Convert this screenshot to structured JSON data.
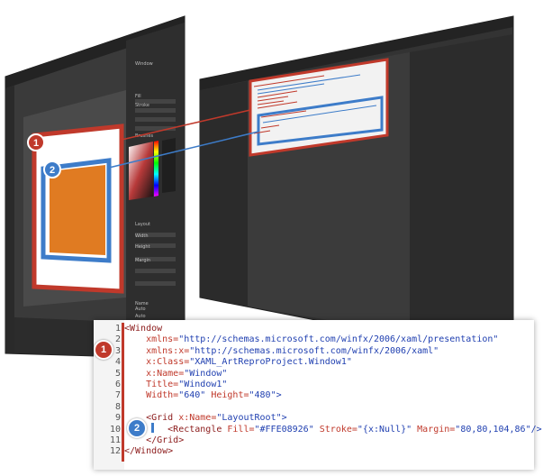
{
  "colors": {
    "accent_red": "#c0392b",
    "accent_blue": "#3d7cc9",
    "rectangle_fill": "#e07b22",
    "editor_bg": "#2b2b2b"
  },
  "callouts": [
    {
      "label": "1"
    },
    {
      "label": "2"
    }
  ],
  "code": {
    "lines": [
      {
        "num": "1",
        "parts": [
          {
            "t": "<Window",
            "c": "kw"
          }
        ]
      },
      {
        "num": "2",
        "parts": [
          {
            "t": "    xmlns=",
            "c": "at"
          },
          {
            "t": "\"http://schemas.microsoft.com/winfx/2006/xaml/presentation\"",
            "c": "st"
          }
        ]
      },
      {
        "num": "3",
        "parts": [
          {
            "t": "    xmlns:x=",
            "c": "at"
          },
          {
            "t": "\"http://schemas.microsoft.com/winfx/2006/xaml\"",
            "c": "st"
          }
        ]
      },
      {
        "num": "4",
        "parts": [
          {
            "t": "    x:Class=",
            "c": "at"
          },
          {
            "t": "\"XAML_ArtReproProject.Window1\"",
            "c": "st"
          }
        ]
      },
      {
        "num": "5",
        "parts": [
          {
            "t": "    x:Name=",
            "c": "at"
          },
          {
            "t": "\"Window\"",
            "c": "st"
          }
        ]
      },
      {
        "num": "6",
        "parts": [
          {
            "t": "    Title=",
            "c": "at"
          },
          {
            "t": "\"Window1\"",
            "c": "st"
          }
        ]
      },
      {
        "num": "7",
        "parts": [
          {
            "t": "    Width=",
            "c": "at"
          },
          {
            "t": "\"640\"",
            "c": "st"
          },
          {
            "t": " Height=",
            "c": "at"
          },
          {
            "t": "\"480\"",
            "c": "st"
          },
          {
            "t": ">",
            "c": "pu"
          }
        ]
      },
      {
        "num": "8",
        "parts": []
      },
      {
        "num": "9",
        "parts": [
          {
            "t": "    <Grid",
            "c": "kw"
          },
          {
            "t": " x:Name=",
            "c": "at"
          },
          {
            "t": "\"LayoutRoot\"",
            "c": "st"
          },
          {
            "t": ">",
            "c": "pu"
          }
        ]
      },
      {
        "num": "10",
        "parts": [
          {
            "t": "        <Rectangle",
            "c": "kw"
          },
          {
            "t": " Fill=",
            "c": "at"
          },
          {
            "t": "\"#FFE08926\"",
            "c": "st"
          },
          {
            "t": " Stroke=",
            "c": "at"
          },
          {
            "t": "\"{x:Null}\"",
            "c": "st"
          },
          {
            "t": " Margin=",
            "c": "at"
          },
          {
            "t": "\"80,80,104,86\"",
            "c": "st"
          },
          {
            "t": "/>",
            "c": "pu"
          }
        ]
      },
      {
        "num": "11",
        "parts": [
          {
            "t": "    </Grid>",
            "c": "kw"
          }
        ]
      },
      {
        "num": "12",
        "parts": [
          {
            "t": "</Window>",
            "c": "kw"
          }
        ]
      }
    ]
  },
  "designer_panel": {
    "labels": [
      "Window",
      "Fill",
      "Stroke",
      "Brushes",
      "Layout",
      "Width",
      "Height",
      "Margin",
      "Name",
      "Auto",
      "Auto"
    ]
  }
}
